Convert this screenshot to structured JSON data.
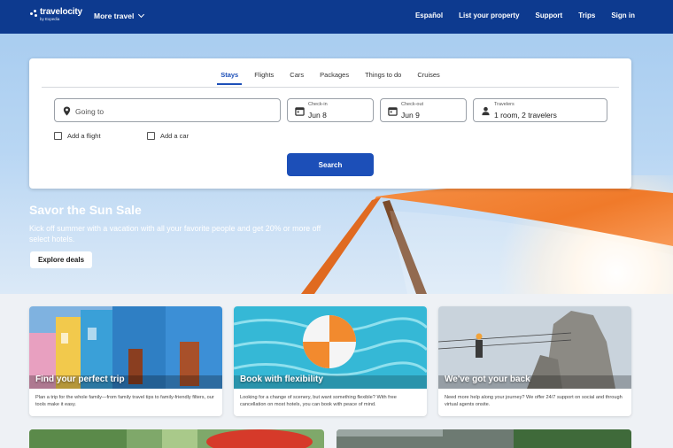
{
  "brand": {
    "name": "travelocity",
    "sub": "by Expedia"
  },
  "nav": {
    "more_travel": "More travel",
    "links": [
      "Español",
      "List your property",
      "Support",
      "Trips",
      "Sign in"
    ]
  },
  "search": {
    "tabs": [
      "Stays",
      "Flights",
      "Cars",
      "Packages",
      "Things to do",
      "Cruises"
    ],
    "active_tab": "Stays",
    "going_to_placeholder": "Going to",
    "checkin": {
      "label": "Check-in",
      "value": "Jun 8"
    },
    "checkout": {
      "label": "Check-out",
      "value": "Jun 9"
    },
    "travelers": {
      "label": "Travelers",
      "value": "1 room, 2 travelers"
    },
    "add_flight": "Add a flight",
    "add_car": "Add a car",
    "search_button": "Search"
  },
  "promo": {
    "title": "Savor the Sun Sale",
    "description": "Kick off summer with a vacation with all your favorite people and get 20% or more off select hotels.",
    "button": "Explore deals"
  },
  "cards": [
    {
      "title": "Find your perfect trip",
      "text": "Plan a trip for the whole family—from family travel tips to family-friendly filters, our tools make it easy."
    },
    {
      "title": "Book with flexibility",
      "text": "Looking for a change of scenery, but want something flexible? With free cancellation on most hotels, you can book with peace of mind."
    },
    {
      "title": "We've got your back",
      "text": "Need more help along your journey? We offer 24/7 support on social and through virtual agents onsite."
    }
  ],
  "colors": {
    "nav_bg": "#0d3a8f",
    "accent": "#1c4fb8",
    "umbrella": "#f07a2a"
  },
  "icons": [
    "location-pin-icon",
    "calendar-icon",
    "person-icon",
    "chevron-down-icon"
  ]
}
